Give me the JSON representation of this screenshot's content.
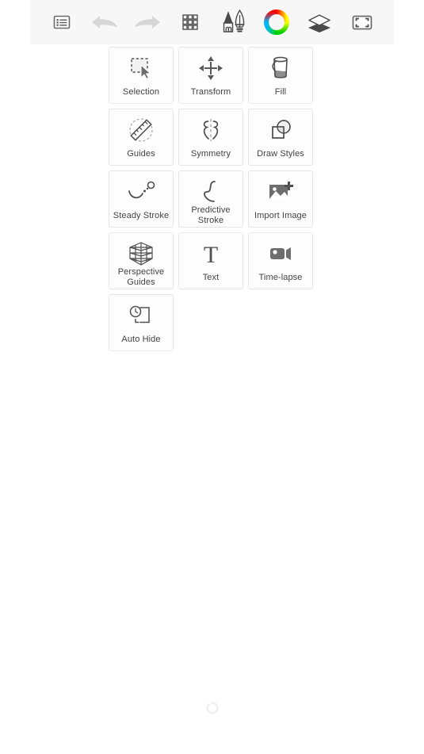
{
  "app": {
    "background_color": "#ffffff",
    "toolbar_background": "#f7f7f7",
    "card_background": "#fdfdfd",
    "card_border_color": "#e6e6e6",
    "icon_color": "#555555",
    "label_color": "#434343",
    "disabled_icon_color": "#d4d4d4"
  },
  "toolbar": {
    "items": [
      {
        "name": "menu-icon",
        "label": "Menu",
        "state": "enabled"
      },
      {
        "name": "undo-icon",
        "label": "Undo",
        "state": "disabled"
      },
      {
        "name": "redo-icon",
        "label": "Redo",
        "state": "disabled"
      },
      {
        "name": "grid-icon",
        "label": "Tools",
        "state": "enabled"
      },
      {
        "name": "brush-pen-icon",
        "label": "Brushes",
        "state": "enabled"
      },
      {
        "name": "color-wheel-icon",
        "label": "Color",
        "state": "enabled"
      },
      {
        "name": "layers-icon",
        "label": "Layers",
        "state": "enabled"
      },
      {
        "name": "fullscreen-icon",
        "label": "Full Screen",
        "state": "enabled"
      }
    ]
  },
  "tool_grid": {
    "rows": [
      [
        {
          "label": "Selection",
          "icon": "selection-icon",
          "lines": 1
        },
        {
          "label": "Transform",
          "icon": "transform-icon",
          "lines": 1
        },
        {
          "label": "Fill",
          "icon": "fill-bucket-icon",
          "lines": 1
        }
      ],
      [
        {
          "label": "Guides",
          "icon": "ruler-icon",
          "lines": 1
        },
        {
          "label": "Symmetry",
          "icon": "symmetry-icon",
          "lines": 1
        },
        {
          "label": "Draw Styles",
          "icon": "draw-styles-icon",
          "lines": 1
        }
      ],
      [
        {
          "label": "Steady Stroke",
          "icon": "steady-stroke-icon",
          "lines": 1
        },
        {
          "label": "Predictive\nStroke",
          "icon": "predictive-stroke-icon",
          "lines": 2
        },
        {
          "label": "Import Image",
          "icon": "import-image-icon",
          "lines": 1
        }
      ],
      [
        {
          "label": "Perspective\nGuides",
          "icon": "perspective-guides-icon",
          "lines": 2
        },
        {
          "label": "Text",
          "icon": "text-icon",
          "lines": 1
        },
        {
          "label": "Time-lapse",
          "icon": "time-lapse-icon",
          "lines": 1
        }
      ],
      [
        {
          "label": "Auto Hide",
          "icon": "auto-hide-icon",
          "lines": 1
        }
      ]
    ]
  },
  "status": {
    "spinner_name": "loading-spinner",
    "spinner_color": "#f0f0f0"
  }
}
